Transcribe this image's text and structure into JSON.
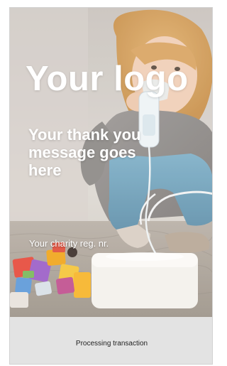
{
  "screen": {
    "logo_text": "Your logo",
    "thank_you_message": "Your thank you message goes here",
    "charity_reg": "Your charity reg. nr.",
    "status": "Processing transaction"
  },
  "background_image": {
    "subject": "child-with-nebulizer-photo"
  },
  "colors": {
    "overlay_text": "#ffffff",
    "status_bar_bg": "#e3e3e3",
    "status_text": "#1f1f1f"
  }
}
